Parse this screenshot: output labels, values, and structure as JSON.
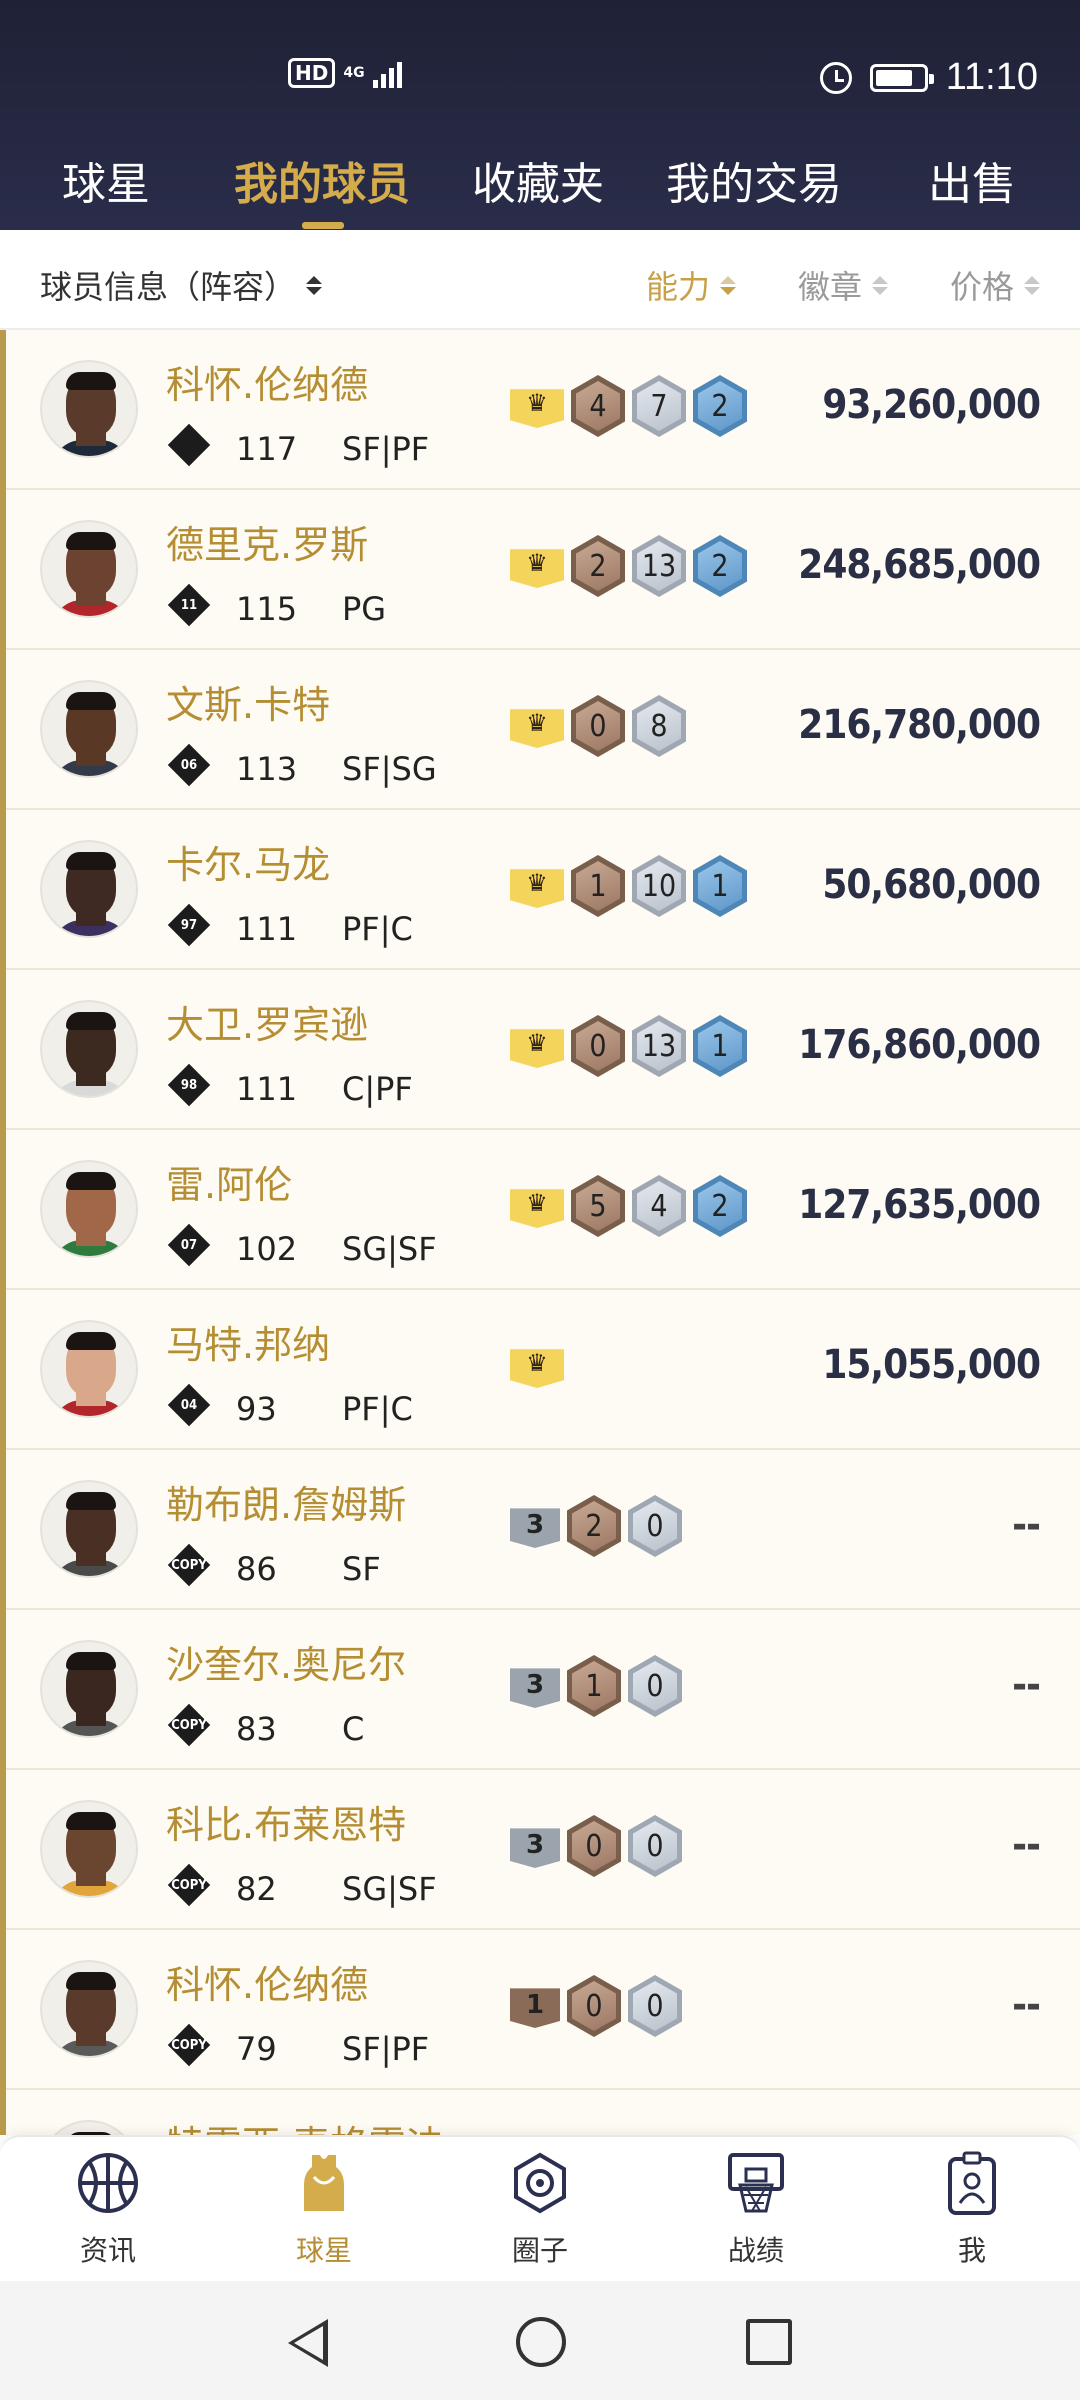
{
  "status": {
    "network": "HD",
    "signal": "4G",
    "time": "11:10"
  },
  "tabs": [
    {
      "label": "球星",
      "active": false
    },
    {
      "label": "我的球员",
      "active": true
    },
    {
      "label": "收藏夹",
      "active": false
    },
    {
      "label": "我的交易",
      "active": false
    },
    {
      "label": "出售",
      "active": false
    }
  ],
  "sort": {
    "info": "球员信息（阵容）",
    "ability": "能力",
    "badge": "徽章",
    "price": "价格"
  },
  "players": [
    {
      "name": "科怀.伦纳德",
      "number": "",
      "rating": "117",
      "pos": "SF|PF",
      "crown": true,
      "tier": "",
      "b1": "4",
      "b2": "7",
      "b3": "2",
      "price": "93,260,000",
      "skin": "#5a3a2a",
      "jersey": "#1e2a3a"
    },
    {
      "name": "德里克.罗斯",
      "number": "11",
      "rating": "115",
      "pos": "PG",
      "crown": true,
      "tier": "",
      "b1": "2",
      "b2": "13",
      "b3": "2",
      "price": "248,685,000",
      "skin": "#6b4330",
      "jersey": "#b0262b"
    },
    {
      "name": "文斯.卡特",
      "number": "06",
      "rating": "113",
      "pos": "SF|SG",
      "crown": true,
      "tier": "",
      "b1": "0",
      "b2": "8",
      "b3": "",
      "price": "216,780,000",
      "skin": "#5a3826",
      "jersey": "#333a4a"
    },
    {
      "name": "卡尔.马龙",
      "number": "97",
      "rating": "111",
      "pos": "PF|C",
      "crown": true,
      "tier": "",
      "b1": "1",
      "b2": "10",
      "b3": "1",
      "price": "50,680,000",
      "skin": "#3e2a22",
      "jersey": "#3b3060"
    },
    {
      "name": "大卫.罗宾逊",
      "number": "98",
      "rating": "111",
      "pos": "C|PF",
      "crown": true,
      "tier": "",
      "b1": "0",
      "b2": "13",
      "b3": "1",
      "price": "176,860,000",
      "skin": "#3c2a20",
      "jersey": "#d9d9d9"
    },
    {
      "name": "雷.阿伦",
      "number": "07",
      "rating": "102",
      "pos": "SG|SF",
      "crown": true,
      "tier": "",
      "b1": "5",
      "b2": "4",
      "b3": "2",
      "price": "127,635,000",
      "skin": "#a06848",
      "jersey": "#2f7a3d"
    },
    {
      "name": "马特.邦纳",
      "number": "04",
      "rating": "93",
      "pos": "PF|C",
      "crown": true,
      "tier": "",
      "b1": "",
      "b2": "",
      "b3": "",
      "price": "15,055,000",
      "skin": "#d9a88a",
      "jersey": "#b0262b"
    },
    {
      "name": "勒布朗.詹姆斯",
      "number": "COPY",
      "rating": "86",
      "pos": "SF",
      "crown": false,
      "tier": "3",
      "b1": "2",
      "b2": "0",
      "b3": "",
      "price": "--",
      "skin": "#4a3024",
      "jersey": "#4a4a4a"
    },
    {
      "name": "沙奎尔.奥尼尔",
      "number": "COPY",
      "rating": "83",
      "pos": "C",
      "crown": false,
      "tier": "3",
      "b1": "1",
      "b2": "0",
      "b3": "",
      "price": "--",
      "skin": "#3a2820",
      "jersey": "#555555"
    },
    {
      "name": "科比.布莱恩特",
      "number": "COPY",
      "rating": "82",
      "pos": "SG|SF",
      "crown": false,
      "tier": "3",
      "b1": "0",
      "b2": "0",
      "b3": "",
      "price": "--",
      "skin": "#6a4630",
      "jersey": "#e0a63a"
    },
    {
      "name": "科怀.伦纳德",
      "number": "COPY",
      "rating": "79",
      "pos": "SF|PF",
      "crown": false,
      "tier": "1",
      "b1": "0",
      "b2": "0",
      "b3": "",
      "price": "--",
      "skin": "#5a3a2a",
      "jersey": "#5a5a5a"
    },
    {
      "name": "特雷西.麦格雷迪",
      "number": "",
      "rating": "",
      "pos": "",
      "crown": false,
      "tier": "",
      "b1": "",
      "b2": "",
      "b3": "",
      "price": "",
      "skin": "#4a3024",
      "jersey": "#333333"
    }
  ],
  "bottom_nav": [
    {
      "label": "资讯",
      "icon": "basketball-icon",
      "active": false
    },
    {
      "label": "球星",
      "icon": "jersey-icon",
      "active": true
    },
    {
      "label": "圈子",
      "icon": "circle-hexagon-icon",
      "active": false
    },
    {
      "label": "战绩",
      "icon": "hoop-icon",
      "active": false
    },
    {
      "label": "我",
      "icon": "id-badge-icon",
      "active": false
    }
  ],
  "colors": {
    "header": "#242742",
    "accent": "#d4ac4c",
    "name": "#b58d33",
    "list_bg": "#fdfbf3"
  }
}
